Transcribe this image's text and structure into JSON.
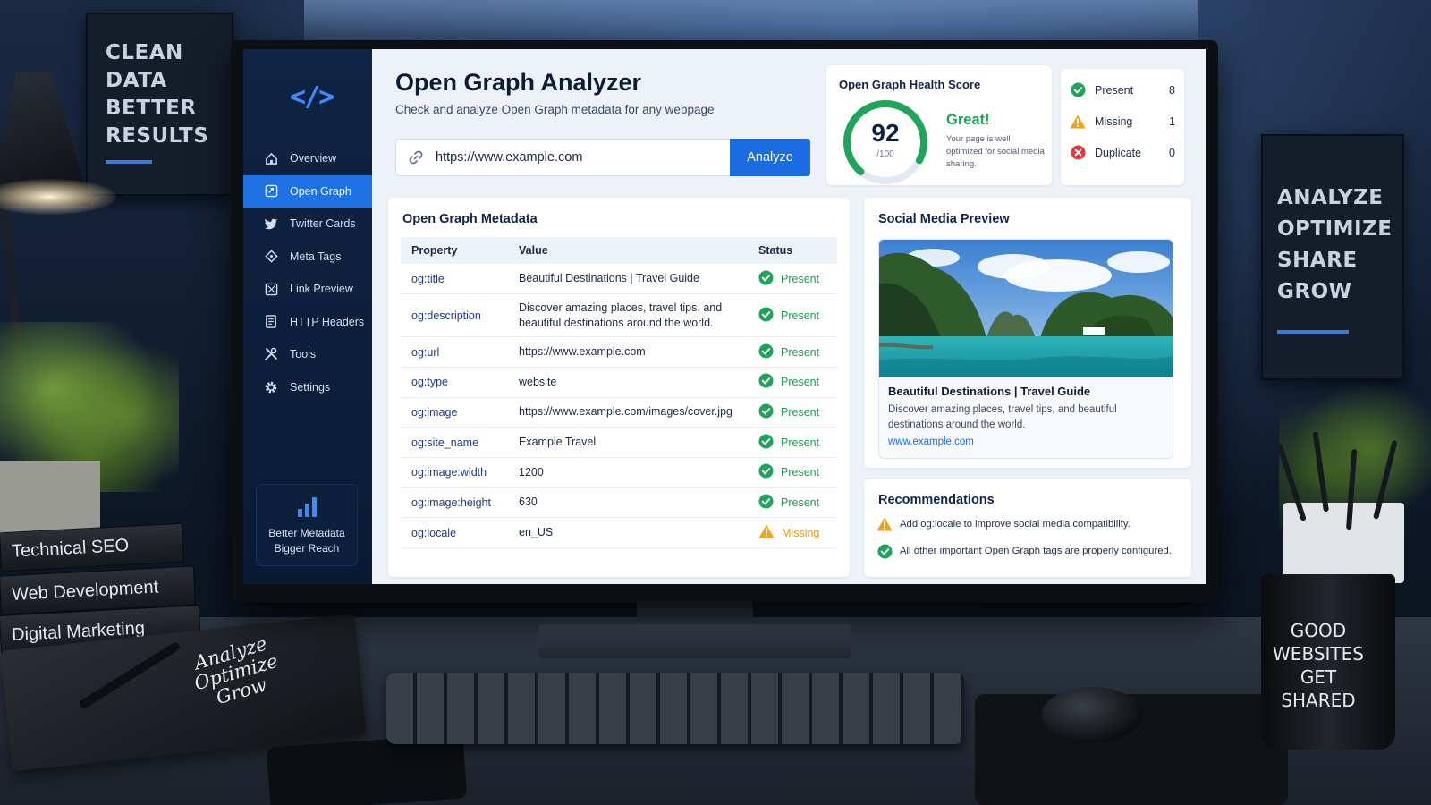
{
  "background": {
    "poster_left": "CLEAN DATA BETTER RESULTS",
    "poster_right": "ANALYZE OPTIMIZE SHARE GROW",
    "books": [
      "Technical SEO",
      "Web Development",
      "Digital Marketing"
    ],
    "notebook": "Analyze Optimize Grow",
    "mug": "GOOD WEBSITES GET SHARED"
  },
  "sidebar": {
    "logo": "</>",
    "items": [
      {
        "label": "Overview",
        "icon": "home-icon"
      },
      {
        "label": "Open Graph",
        "icon": "share-icon",
        "active": true
      },
      {
        "label": "Twitter Cards",
        "icon": "twitter-icon"
      },
      {
        "label": "Meta Tags",
        "icon": "tag-icon"
      },
      {
        "label": "Link Preview",
        "icon": "image-icon"
      },
      {
        "label": "HTTP Headers",
        "icon": "document-icon"
      },
      {
        "label": "Tools",
        "icon": "tools-icon"
      },
      {
        "label": "Settings",
        "icon": "gear-icon"
      }
    ],
    "promo": {
      "line1": "Better Metadata",
      "line2": "Bigger Reach"
    }
  },
  "header": {
    "title": "Open Graph Analyzer",
    "subtitle": "Check and analyze Open Graph metadata for any webpage"
  },
  "search": {
    "value": "https://www.example.com",
    "button": "Analyze"
  },
  "health": {
    "title": "Open Graph Health Score",
    "score": "92",
    "out_of": "/100",
    "score_fraction": 0.92,
    "verdict": "Great!",
    "description": "Your page is well optimized for social media sharing.",
    "accent": "#1fa45a"
  },
  "stats": [
    {
      "label": "Present",
      "count": "8",
      "icon": "check-circle-icon",
      "color": "#1fa45a"
    },
    {
      "label": "Missing",
      "count": "1",
      "icon": "warning-icon",
      "color": "#f0a21b"
    },
    {
      "label": "Duplicate",
      "count": "0",
      "icon": "error-circle-icon",
      "color": "#e5383b"
    }
  ],
  "metadata": {
    "title": "Open Graph Metadata",
    "columns": [
      "Property",
      "Value",
      "Status"
    ],
    "rows": [
      {
        "property": "og:title",
        "value": "Beautiful Destinations | Travel Guide",
        "status": "Present"
      },
      {
        "property": "og:description",
        "value": "Discover amazing places, travel tips, and beautiful destinations around the world.",
        "status": "Present"
      },
      {
        "property": "og:url",
        "value": "https://www.example.com",
        "status": "Present"
      },
      {
        "property": "og:type",
        "value": "website",
        "status": "Present"
      },
      {
        "property": "og:image",
        "value": "https://www.example.com/images/cover.jpg",
        "status": "Present"
      },
      {
        "property": "og:site_name",
        "value": "Example Travel",
        "status": "Present"
      },
      {
        "property": "og:image:width",
        "value": "1200",
        "status": "Present"
      },
      {
        "property": "og:image:height",
        "value": "630",
        "status": "Present"
      },
      {
        "property": "og:locale",
        "value": "en_US",
        "status": "Missing"
      }
    ]
  },
  "preview": {
    "title": "Social Media Preview",
    "card_title": "Beautiful Destinations | Travel Guide",
    "card_desc": "Discover amazing places, travel tips, and beautiful destinations around the world.",
    "card_url": "www.example.com"
  },
  "recommendations": {
    "title": "Recommendations",
    "items": [
      {
        "text": "Add og:locale to improve social media compatibility.",
        "icon": "warning-icon"
      },
      {
        "text": "All other important Open Graph tags are properly configured.",
        "icon": "check-circle-icon"
      }
    ]
  }
}
